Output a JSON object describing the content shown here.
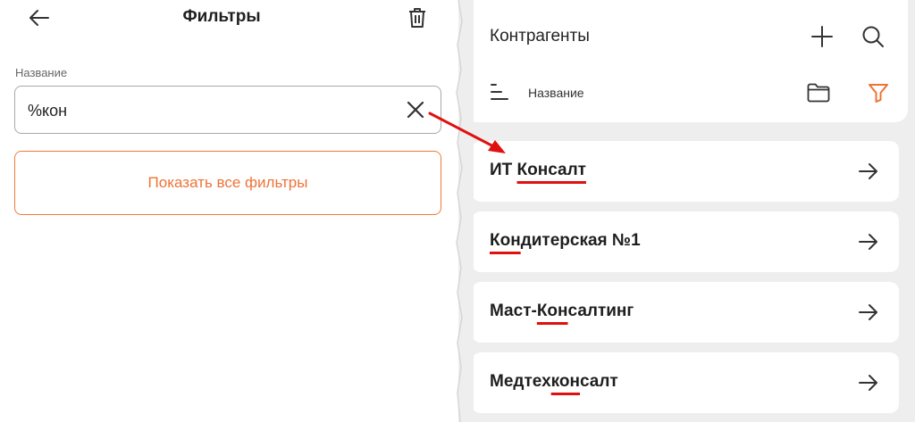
{
  "filters": {
    "title": "Фильтры",
    "name_label": "Название",
    "search_value": "%кон",
    "show_all_label": "Показать все фильтры"
  },
  "contractors": {
    "title": "Контрагенты",
    "sort_label": "Название",
    "items": [
      {
        "pre": "ИТ ",
        "hl": "Консалт",
        "post": ""
      },
      {
        "pre": "",
        "hl": "Кон",
        "post": "дитерская №1"
      },
      {
        "pre": "Маст-",
        "hl": "Кон",
        "post": "салтинг"
      },
      {
        "pre": "Медтех",
        "hl": "кон",
        "post": "салт"
      }
    ]
  },
  "colors": {
    "accent_orange": "#ee7336",
    "highlight_red": "#e01010",
    "panel_bg": "#eeeeee"
  }
}
